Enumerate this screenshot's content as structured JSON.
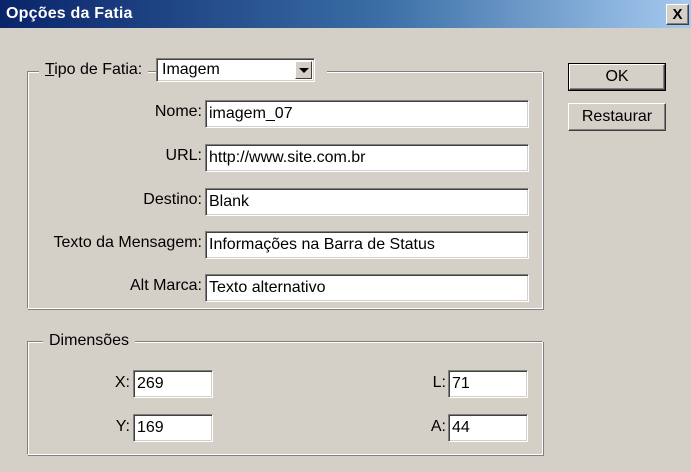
{
  "window": {
    "title": "Opções da Fatia",
    "close_label": "X"
  },
  "slice_group": {
    "type_label": "Tipo de Fatia:",
    "type_label_first": "T",
    "type_label_rest": "ipo de Fatia:",
    "type_value": "Imagem"
  },
  "fields": {
    "name": {
      "label": "Nome:",
      "value": "imagem_07"
    },
    "url": {
      "label": "URL:",
      "value": "http://www.site.com.br"
    },
    "target": {
      "label": "Destino:",
      "value": "Blank"
    },
    "message": {
      "label": "Texto da Mensagem:",
      "value": "Informações na Barra de Status"
    },
    "alt": {
      "label": "Alt Marca:",
      "value": "Texto alternativo"
    }
  },
  "dimensions": {
    "legend": "Dimensões",
    "x": {
      "label": "X:",
      "value": "269"
    },
    "y": {
      "label": "Y:",
      "value": "169"
    },
    "l": {
      "label": "L:",
      "value": "71"
    },
    "a": {
      "label": "A:",
      "value": "44"
    }
  },
  "buttons": {
    "ok": "OK",
    "reset": "Restaurar"
  }
}
